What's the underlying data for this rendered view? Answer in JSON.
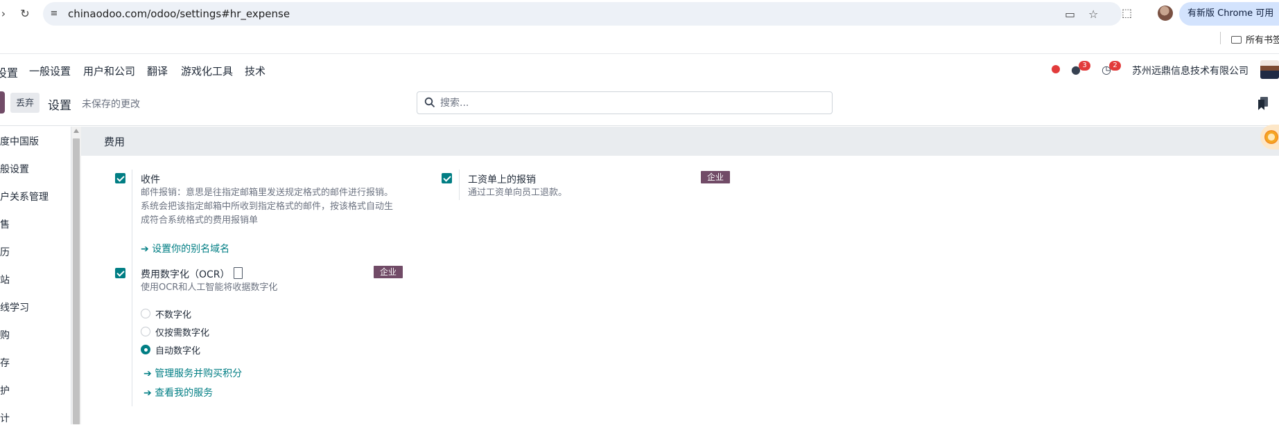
{
  "browser": {
    "url": "chinaodoo.com/odoo/settings#hr_expense",
    "update_label": "有新版 Chrome 可用",
    "bookmarks_label": "所有书签"
  },
  "navbar": {
    "app_name": "设置",
    "menu": [
      "一般设置",
      "用户和公司",
      "翻译",
      "游戏化工具",
      "技术"
    ],
    "messages_count": "3",
    "activities_count": "2",
    "company": "苏州远鼎信息技术有限公司"
  },
  "control_panel": {
    "discard_label": "丢弃",
    "title": "设置",
    "unsaved": "未保存的更改",
    "search_placeholder": "搜索..."
  },
  "sidebar": {
    "items": [
      "速度中国版",
      "一般设置",
      "客户关系管理",
      "销售",
      "日历",
      "网站",
      "在线学习",
      "采购",
      "库存",
      "维护",
      "会计"
    ]
  },
  "section": {
    "title": "费用"
  },
  "settings": {
    "incoming": {
      "title": "收件",
      "desc_lines": [
        "邮件报销：意思是往指定邮箱里发送规定格式的邮件进行报销。",
        "系统会把该指定邮箱中所收到指定格式的邮件，按该格式自动生",
        "成符合系统格式的费用报销单"
      ],
      "link": "设置你的别名域名",
      "checked": true
    },
    "payslip": {
      "title": "工资单上的报销",
      "desc": "通过工资单向员工退款。",
      "badge": "企业",
      "checked": true
    },
    "ocr": {
      "title": "费用数字化（OCR）",
      "desc": "使用OCR和人工智能将收据数字化",
      "badge": "企业",
      "checked": true,
      "options": [
        "不数字化",
        "仅按需数字化",
        "自动数字化"
      ],
      "selected": "自动数字化",
      "link_manage": "管理服务并购买积分",
      "link_view": "查看我的服务"
    }
  },
  "colors": {
    "brand": "#714b67",
    "accent": "#017e84",
    "badge_red": "#e23b3b"
  }
}
